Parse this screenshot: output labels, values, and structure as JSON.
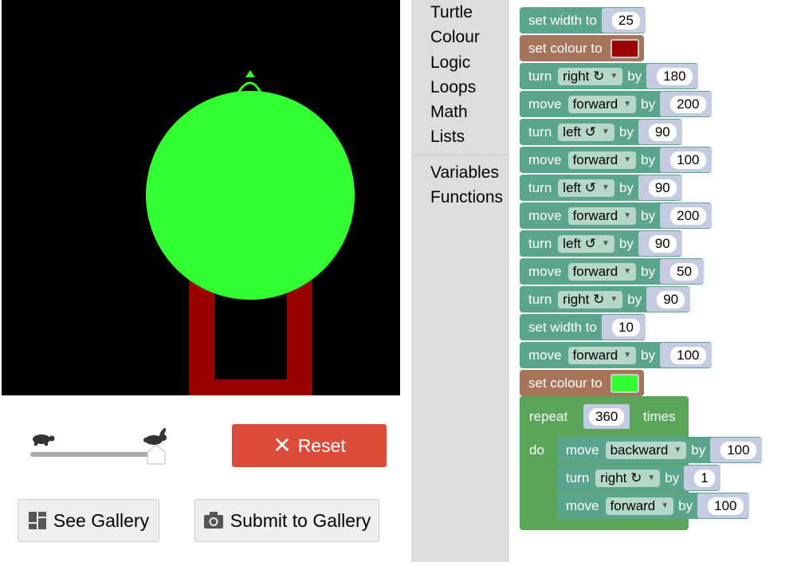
{
  "toolbox": {
    "items": [
      "Turtle",
      "Colour",
      "Logic",
      "Loops",
      "Math",
      "Lists"
    ],
    "items2": [
      "Variables",
      "Functions"
    ]
  },
  "controls": {
    "reset_label": "Reset",
    "gallery_label": "See Gallery",
    "submit_label": "Submit to Gallery",
    "speed_level": 1.0
  },
  "colors": {
    "canvas_bg": "#000000",
    "red_shape": "#990000",
    "green_circle": "#33ff33",
    "reset_button": "#dd4b39"
  },
  "blocks": [
    {
      "kind": "set_width",
      "label": "set width to",
      "value": "25"
    },
    {
      "kind": "set_colour",
      "label": "set colour to",
      "color": "#990000"
    },
    {
      "kind": "turn",
      "label": "turn",
      "dir": "right ↻",
      "by": "by",
      "value": "180"
    },
    {
      "kind": "move",
      "label": "move",
      "dir": "forward",
      "by": "by",
      "value": "200"
    },
    {
      "kind": "turn",
      "label": "turn",
      "dir": "left ↺",
      "by": "by",
      "value": "90"
    },
    {
      "kind": "move",
      "label": "move",
      "dir": "forward",
      "by": "by",
      "value": "100"
    },
    {
      "kind": "turn",
      "label": "turn",
      "dir": "left ↺",
      "by": "by",
      "value": "90"
    },
    {
      "kind": "move",
      "label": "move",
      "dir": "forward",
      "by": "by",
      "value": "200"
    },
    {
      "kind": "turn",
      "label": "turn",
      "dir": "left ↺",
      "by": "by",
      "value": "90"
    },
    {
      "kind": "move",
      "label": "move",
      "dir": "forward",
      "by": "by",
      "value": "50"
    },
    {
      "kind": "turn",
      "label": "turn",
      "dir": "right ↻",
      "by": "by",
      "value": "90"
    },
    {
      "kind": "set_width",
      "label": "set width to",
      "value": "10"
    },
    {
      "kind": "move",
      "label": "move",
      "dir": "forward",
      "by": "by",
      "value": "100"
    },
    {
      "kind": "set_colour",
      "label": "set colour to",
      "color": "#33ff33"
    }
  ],
  "repeat": {
    "label": "repeat",
    "count": "360",
    "times": "times",
    "do": "do",
    "body": [
      {
        "kind": "move",
        "label": "move",
        "dir": "backward",
        "by": "by",
        "value": "100"
      },
      {
        "kind": "turn",
        "label": "turn",
        "dir": "right ↻",
        "by": "by",
        "value": "1"
      },
      {
        "kind": "move",
        "label": "move",
        "dir": "forward",
        "by": "by",
        "value": "100"
      }
    ]
  }
}
